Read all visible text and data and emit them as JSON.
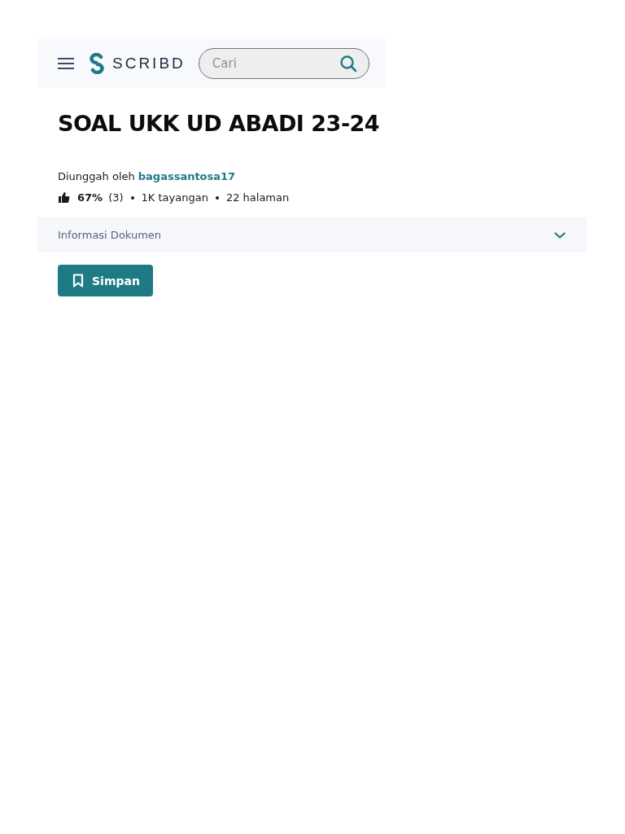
{
  "header": {
    "logo": "SCRIBD",
    "search": {
      "placeholder": "Cari"
    }
  },
  "document": {
    "title": "SOAL UKK UD ABADI 23-24",
    "uploaded_by_label": "Diunggah oleh",
    "uploader": "bagassantosa17",
    "stats": {
      "rating": "67%",
      "rating_count": "(3)",
      "views": "1K tayangan",
      "pages": "22 halaman"
    }
  },
  "info_panel": {
    "label": "Informasi Dokumen",
    "expanded": false
  },
  "buttons": [
    {
      "label": "Simpan"
    }
  ]
}
